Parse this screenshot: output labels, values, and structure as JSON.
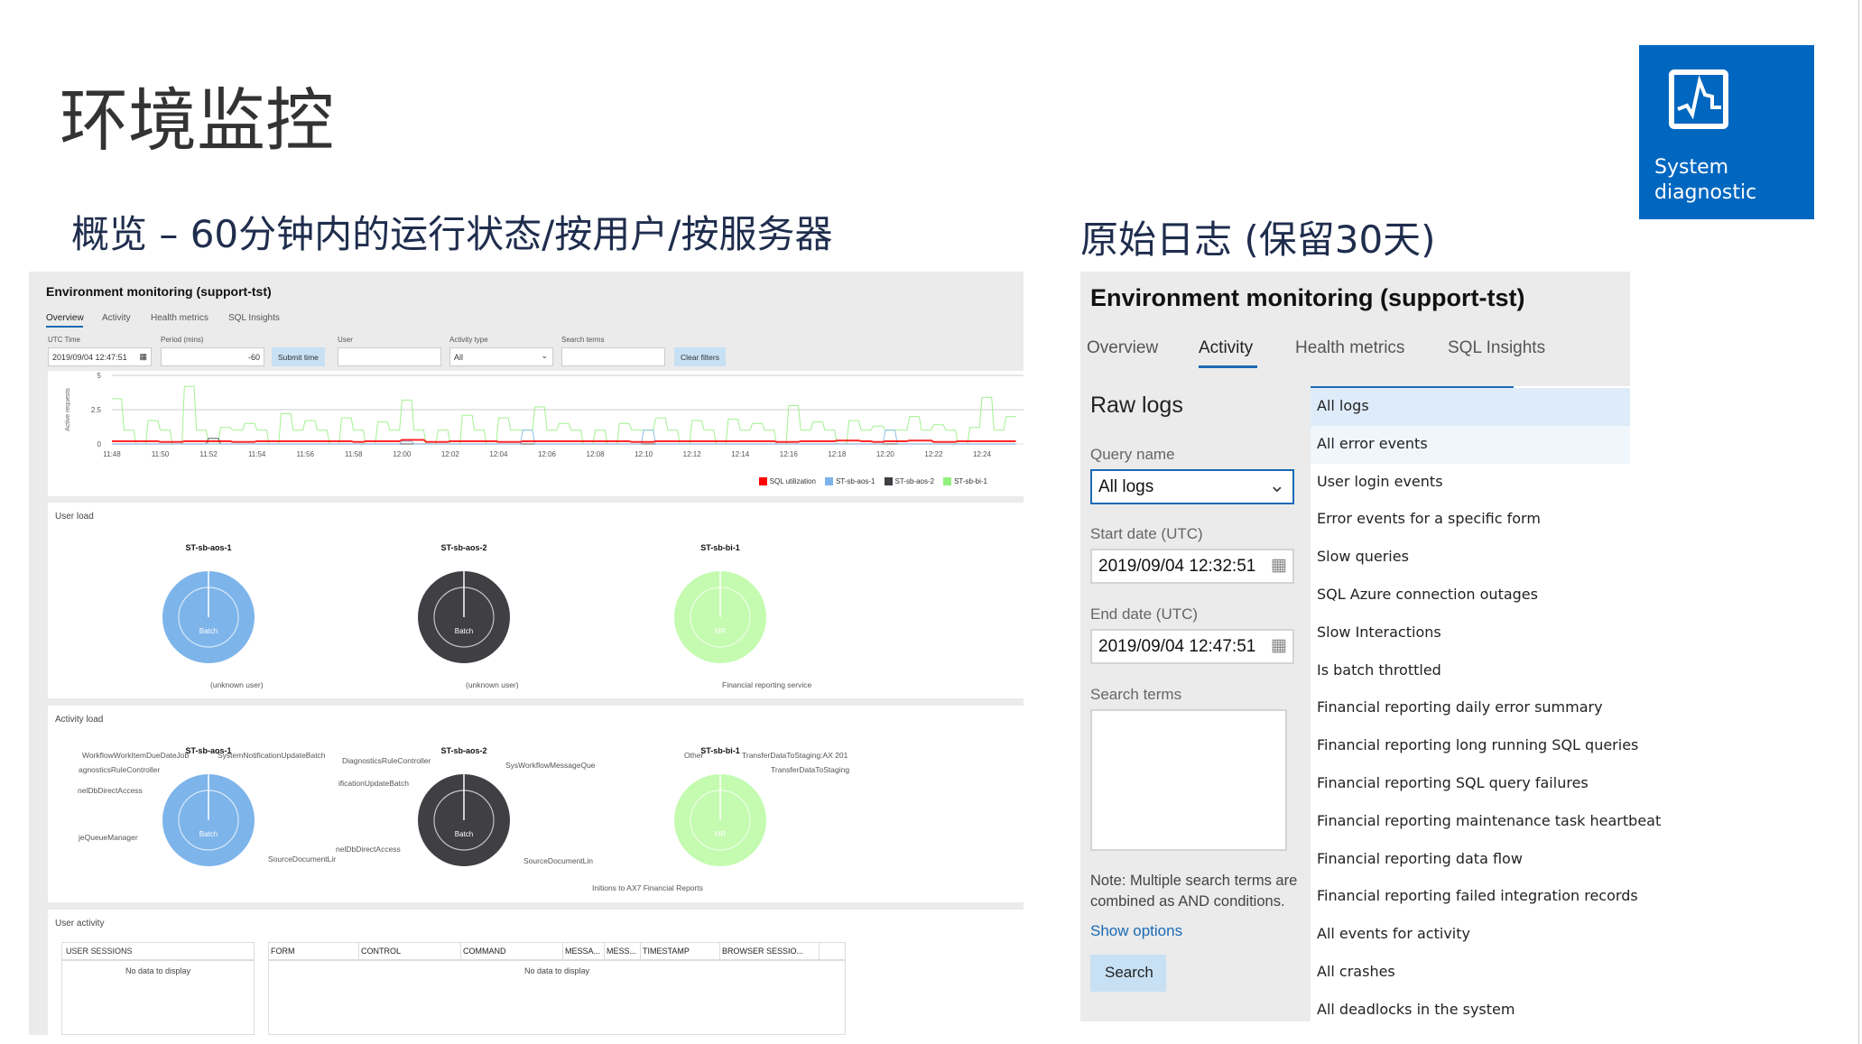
{
  "slide": {
    "title": "环境监控",
    "subtitle_left": "概览 – 60分钟内的运行状态/按用户/按服务器",
    "subtitle_right": "原始日志 (保留30天)"
  },
  "tile": {
    "label_line1": "System",
    "label_line2": "diagnostic",
    "icon": "chart-pulse-icon",
    "color": "#0067c0"
  },
  "overview": {
    "title": "Environment monitoring (support-tst)",
    "tabs": [
      "Overview",
      "Activity",
      "Health metrics",
      "SQL Insights"
    ],
    "active_tab": "Overview",
    "filters": {
      "utc_time_label": "UTC Time",
      "utc_time": "2019/09/04 12:47:51",
      "period_label": "Period (mins)",
      "period": "-60",
      "submit": "Submit time",
      "user_label": "User",
      "user": "",
      "activity_label": "Activity type",
      "activity": "All",
      "search_label": "Search terms",
      "search": "",
      "clear": "Clear filters"
    },
    "user_load": {
      "title": "User load",
      "servers": [
        {
          "name": "ST-sb-aos-1",
          "center": "Batch",
          "labels": [
            "(unknown user)"
          ],
          "color": "#7db4ea"
        },
        {
          "name": "ST-sb-aos-2",
          "center": "Batch",
          "labels": [
            "(unknown user)"
          ],
          "color": "#3f3f44"
        },
        {
          "name": "ST-sb-bi-1",
          "center": "MR",
          "labels": [
            "Financial reporting service"
          ],
          "color": "#c4fbb0"
        }
      ]
    },
    "activity_load": {
      "title": "Activity load",
      "servers": [
        {
          "name": "ST-sb-aos-1",
          "center": "Batch",
          "labels": [
            "WorkflowWorkItemDueDateJob",
            "SystemNotificationUpdateBatch",
            "agnosticsRuleController",
            "nelDbDirectAccess",
            "jeQueueManager",
            "SourceDocumentLir"
          ]
        },
        {
          "name": "ST-sb-aos-2",
          "center": "Batch",
          "labels": [
            "DiagnosticsRuleController",
            "SysWorkflowMessageQue",
            "ificationUpdateBatch",
            "nelDbDirectAccess",
            "SourceDocumentLin"
          ]
        },
        {
          "name": "ST-sb-bi-1",
          "center": "MR",
          "labels": [
            "Other",
            "TransferDataToStaging:AX 201",
            "TransferDataToStaging",
            "Initions to AX7 Financial Reports"
          ]
        }
      ]
    },
    "user_activity": {
      "title": "User activity",
      "sessions_header": "USER SESSIONS",
      "columns": [
        "FORM",
        "CONTROL",
        "COMMAND",
        "MESSA...",
        "MESS...",
        "TIMESTAMP",
        "BROWSER SESSIO..."
      ],
      "empty": "No data to display"
    }
  },
  "chart_data": {
    "type": "line",
    "ylabel": "Active requests",
    "ylim": [
      0,
      5
    ],
    "yticks": [
      "0",
      "2.5",
      "5"
    ],
    "xticks": [
      "11:48",
      "11:50",
      "11:52",
      "11:54",
      "11:56",
      "11:58",
      "12:00",
      "12:02",
      "12:04",
      "12:06",
      "12:08",
      "12:10",
      "12:12",
      "12:14",
      "12:16",
      "12:18",
      "12:20",
      "12:22",
      "12:24"
    ],
    "x_start": "11:48",
    "x_step_minutes": 0.5,
    "legend_position": "bottom-right",
    "grid": true,
    "series": [
      {
        "name": "SQL utilization",
        "color": "#ff0000",
        "values": [
          0.2,
          0.2,
          0.2,
          0.2,
          0.15,
          0.15,
          0.2,
          0.2,
          0.2,
          0.2,
          0.15,
          0.15,
          0.2,
          0.2,
          0.2,
          0.2,
          0.2,
          0.2,
          0.2,
          0.2,
          0.15,
          0.2,
          0.2,
          0.2,
          0.3,
          0.3,
          0.15,
          0.15,
          0.2,
          0.2,
          0.2,
          0.2,
          0.15,
          0.15,
          0.2,
          0.2,
          0.2,
          0.2,
          0.2,
          0.2,
          0.2,
          0.2,
          0.2,
          0.15,
          0.15,
          0.2,
          0.2,
          0.2,
          0.2,
          0.2,
          0.2,
          0.2,
          0.2,
          0.2,
          0.2,
          0.15,
          0.15,
          0.2,
          0.2,
          0.2,
          0.25,
          0.25,
          0.2,
          0.15,
          0.2,
          0.2,
          0.25,
          0.25,
          0.15,
          0.15,
          0.2,
          0.2,
          0.2,
          0.2,
          0.2
        ]
      },
      {
        "name": "ST-sb-aos-1",
        "color": "#7db4ea",
        "values": [
          0,
          0,
          0,
          0,
          0,
          0,
          0,
          0,
          0,
          0,
          0,
          0,
          0,
          0,
          0,
          0,
          0,
          0,
          0,
          0,
          0,
          0,
          0,
          0,
          0.2,
          0,
          0,
          0,
          0,
          0,
          0,
          0,
          0,
          0,
          1,
          0,
          0,
          0,
          0,
          0,
          0,
          0,
          0,
          0,
          1,
          0,
          0,
          0,
          0,
          0,
          0,
          0,
          0,
          0,
          0,
          0,
          0,
          0,
          0,
          0,
          0,
          0,
          0,
          0,
          1,
          0,
          0,
          0,
          0,
          0,
          0,
          0,
          0,
          0,
          0
        ]
      },
      {
        "name": "ST-sb-aos-2",
        "color": "#3f3f44",
        "values": [
          0,
          0,
          0,
          0,
          0,
          0,
          0,
          0,
          0.4,
          0,
          0,
          0,
          0,
          0,
          0,
          0,
          0,
          0,
          0,
          0,
          0,
          0,
          0,
          0,
          0,
          0,
          0,
          0,
          0,
          0,
          0,
          0,
          0,
          0,
          0,
          0,
          0,
          0,
          0,
          0,
          0,
          0,
          0,
          0,
          0,
          0,
          0,
          0,
          0,
          0,
          0,
          0,
          0,
          0,
          0,
          0,
          0,
          0,
          0,
          0,
          0,
          0,
          0,
          0,
          0,
          0,
          0,
          0,
          0,
          0,
          0,
          0,
          0,
          0,
          0
        ]
      },
      {
        "name": "ST-sb-bi-1",
        "color": "#92ef7c",
        "values": [
          3.3,
          1,
          0,
          1.7,
          1,
          0,
          4.2,
          1,
          0,
          1.2,
          1,
          1.5,
          1,
          0,
          2.2,
          1,
          1.7,
          1,
          0,
          1.9,
          1,
          0,
          1.6,
          1,
          3.2,
          1,
          0,
          1,
          0,
          2.1,
          1,
          0,
          1.9,
          1,
          1,
          2.7,
          1,
          1.5,
          1,
          0,
          1,
          0,
          1.5,
          1,
          1,
          1.9,
          1,
          0,
          1.7,
          1,
          0,
          1.8,
          1,
          1.5,
          1,
          0,
          2.8,
          1,
          1.6,
          1,
          0,
          1.7,
          1,
          1.3,
          1,
          1,
          2,
          1,
          1.4,
          1,
          0,
          1.2,
          3.4,
          1,
          2
        ]
      }
    ]
  },
  "raw_logs": {
    "title": "Environment monitoring (support-tst)",
    "tabs": [
      "Overview",
      "Activity",
      "Health metrics",
      "SQL Insights"
    ],
    "active_tab": "Activity",
    "heading": "Raw logs",
    "query_label": "Query name",
    "query_value": "All logs",
    "start_label": "Start date (UTC)",
    "start_value": "2019/09/04 12:32:51",
    "end_label": "End date (UTC)",
    "end_value": "2019/09/04 12:47:51",
    "search_label": "Search terms",
    "search_value": "",
    "note": "Note: Multiple search terms are combined as AND conditions.",
    "show_options": "Show options",
    "search_button": "Search",
    "options": [
      "All logs",
      "All error events",
      "User login events",
      "Error events for a specific form",
      "Slow queries",
      "SQL Azure connection outages",
      "Slow Interactions",
      "Is batch throttled",
      "Financial reporting daily error summary",
      "Financial reporting long running SQL queries",
      "Financial reporting SQL query failures",
      "Financial reporting maintenance task heartbeat",
      "Financial reporting data flow",
      "Financial reporting failed integration records",
      "All events for activity",
      "All crashes",
      "All deadlocks in the system"
    ],
    "selected_option": "All logs",
    "hover_option": "All error events"
  }
}
